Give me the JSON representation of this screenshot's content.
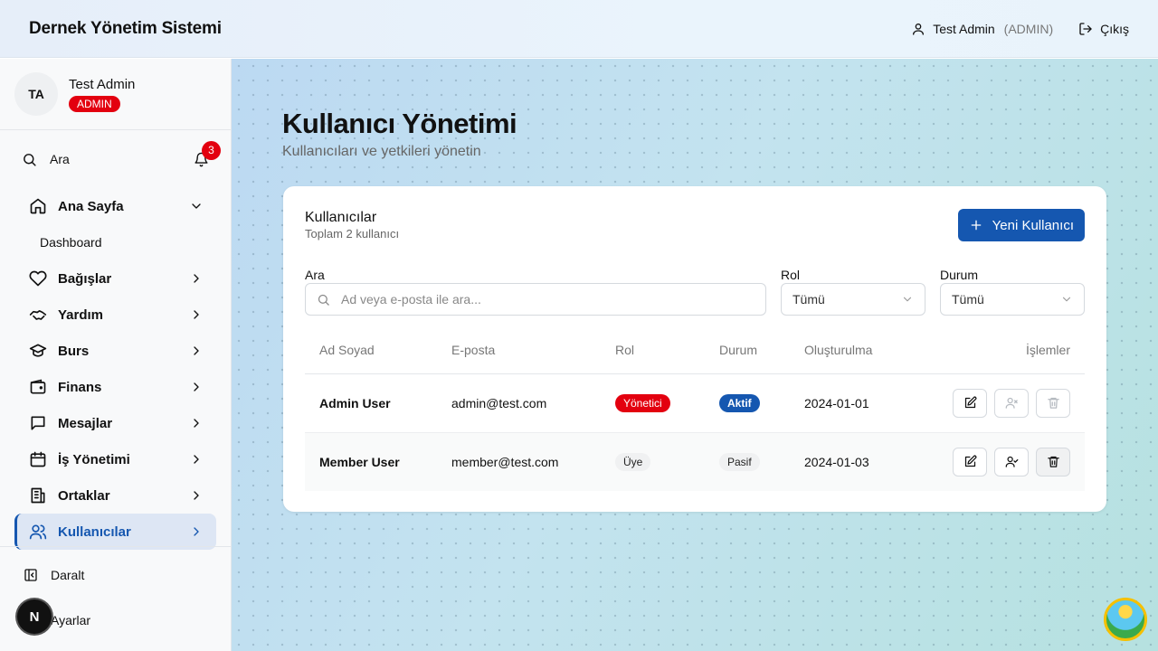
{
  "header": {
    "title": "Dernek Yönetim Sistemi",
    "user_name": "Test Admin",
    "user_role": "(ADMIN)",
    "logout_label": "Çıkış"
  },
  "sidebar": {
    "avatar_initials": "TA",
    "profile_name": "Test Admin",
    "profile_role": "ADMIN",
    "search_label": "Ara",
    "notification_count": "3",
    "items": [
      {
        "label": "Ana Sayfa",
        "icon": "home-icon"
      },
      {
        "label": "Dashboard"
      },
      {
        "label": "Bağışlar",
        "icon": "heart-icon"
      },
      {
        "label": "Yardım",
        "icon": "handshake-icon"
      },
      {
        "label": "Burs",
        "icon": "graduation-cap-icon"
      },
      {
        "label": "Finans",
        "icon": "wallet-icon"
      },
      {
        "label": "Mesajlar",
        "icon": "message-icon"
      },
      {
        "label": "İş Yönetimi",
        "icon": "calendar-icon"
      },
      {
        "label": "Ortaklar",
        "icon": "building-icon"
      },
      {
        "label": "Kullanıcılar",
        "icon": "users-icon"
      }
    ],
    "collapse_label": "Daralt",
    "settings_label": "Ayarlar",
    "dev_badge": "N"
  },
  "main": {
    "page_title": "Kullanıcı Yönetimi",
    "page_subtitle": "Kullanıcıları ve yetkileri yönetin",
    "card_title": "Kullanıcılar",
    "card_subtitle": "Toplam 2 kullanıcı",
    "new_user_label": "Yeni Kullanıcı",
    "filters": {
      "search_label": "Ara",
      "search_placeholder": "Ad veya e-posta ile ara...",
      "role_label": "Rol",
      "role_value": "Tümü",
      "status_label": "Durum",
      "status_value": "Tümü"
    },
    "table": {
      "columns": [
        "Ad Soyad",
        "E-posta",
        "Rol",
        "Durum",
        "Oluşturulma",
        "İşlemler"
      ],
      "rows": [
        {
          "name": "Admin User",
          "email": "admin@test.com",
          "role": "Yönetici",
          "status": "Aktif",
          "created": "2024-01-01"
        },
        {
          "name": "Member User",
          "email": "member@test.com",
          "role": "Üye",
          "status": "Pasif",
          "created": "2024-01-03"
        }
      ]
    }
  },
  "colors": {
    "accent": "#1557b0",
    "danger": "#e3000f"
  }
}
